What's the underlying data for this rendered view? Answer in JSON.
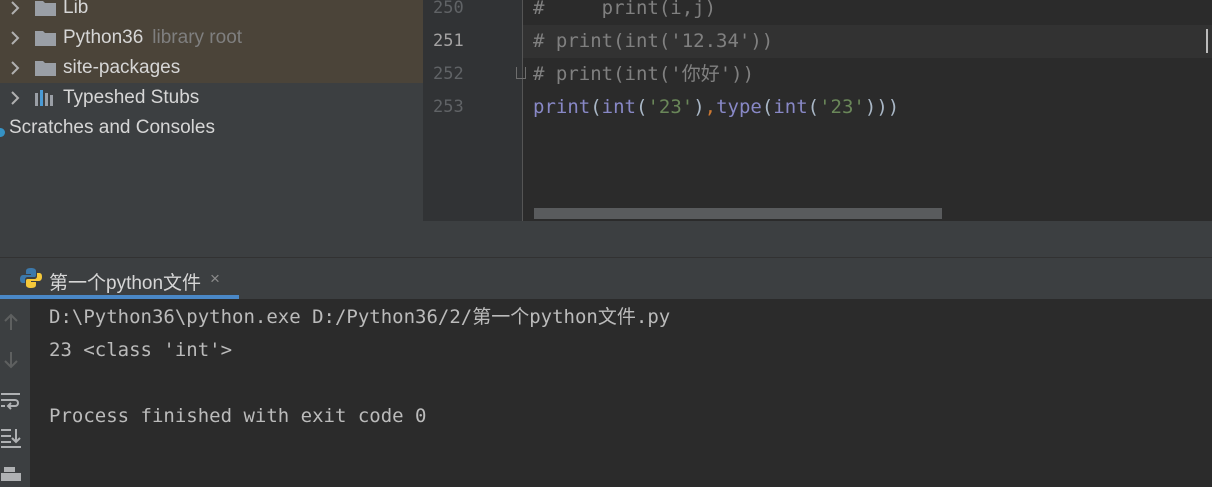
{
  "project_tree": {
    "items": [
      {
        "label": "Lib",
        "hint": ""
      },
      {
        "label": "Python36",
        "hint": "library root"
      },
      {
        "label": "site-packages",
        "hint": ""
      },
      {
        "label": "Typeshed Stubs",
        "hint": ""
      }
    ],
    "scratches_label": "Scratches and Consoles"
  },
  "editor": {
    "lines": [
      {
        "number": "250",
        "text": "#     print(i,j)"
      },
      {
        "number": "251",
        "text": "# print(int('12.34'))"
      },
      {
        "number": "252",
        "text": "# print(int('你好'))"
      },
      {
        "number": "253",
        "text": "print(int('23'),type(int('23')))"
      }
    ],
    "current_line": "251"
  },
  "run": {
    "tab_label": "第一个python文件",
    "close_glyph": "×",
    "output": [
      "D:\\Python36\\python.exe D:/Python36/2/第一个python文件.py",
      "23 <class 'int'>",
      "",
      "Process finished with exit code 0"
    ]
  },
  "colors": {
    "accent": "#4a88c7",
    "folder": "#9a9fa6",
    "string": "#6a8759",
    "builtin": "#8888c6",
    "comment": "#808080"
  }
}
